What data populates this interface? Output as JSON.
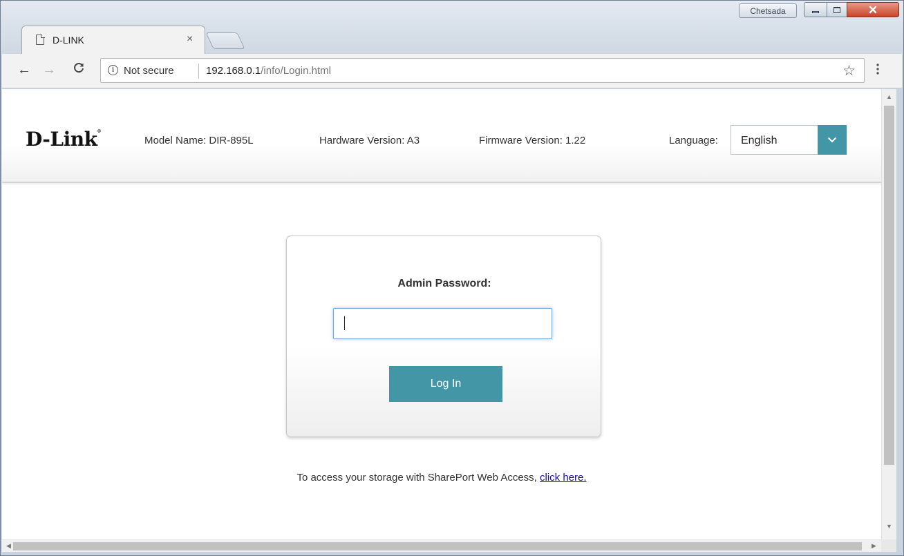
{
  "window": {
    "profile_name": "Chetsada",
    "minimize_icon": "minimize-icon",
    "maximize_icon": "maximize-icon",
    "close_icon": "close-icon"
  },
  "tab": {
    "title": "D-LINK",
    "close_glyph": "×",
    "favicon": "page-icon"
  },
  "toolbar": {
    "back_glyph": "←",
    "forward_glyph": "→",
    "reload_glyph": "C",
    "security_label": "Not secure",
    "url_host": "192.168.0.1",
    "url_path": "/info/Login.html",
    "star_glyph": "☆",
    "menu_glyph": "⋮"
  },
  "header": {
    "logo": "D-Link",
    "logo_mark": "®",
    "model_name": "Model Name: DIR-895L",
    "hardware_version": "Hardware Version: A3",
    "firmware_version": "Firmware Version: 1.22",
    "language_label": "Language:",
    "language_selected": "English"
  },
  "login": {
    "password_label": "Admin Password:",
    "password_value": "",
    "login_button": "Log In"
  },
  "footer": {
    "storage_text": "To access your storage with SharePort Web Access,",
    "storage_link": "click here."
  },
  "colors": {
    "accent": "#4296a5",
    "link": "#1a0dab"
  }
}
